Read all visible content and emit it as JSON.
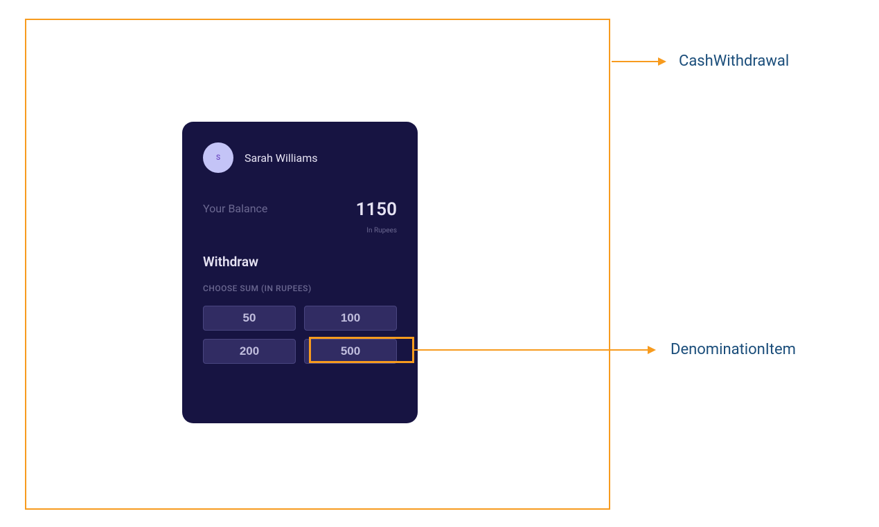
{
  "annotations": {
    "outer_label": "CashWithdrawal",
    "denom_label": "DenominationItem"
  },
  "card": {
    "user": {
      "initial": "S",
      "name": "Sarah Williams"
    },
    "balance": {
      "label": "Your Balance",
      "amount": "1150",
      "unit": "In Rupees"
    },
    "withdraw": {
      "title": "Withdraw",
      "choose_label": "CHOOSE SUM (IN RUPEES)"
    },
    "denominations": [
      "50",
      "100",
      "200",
      "500"
    ]
  }
}
